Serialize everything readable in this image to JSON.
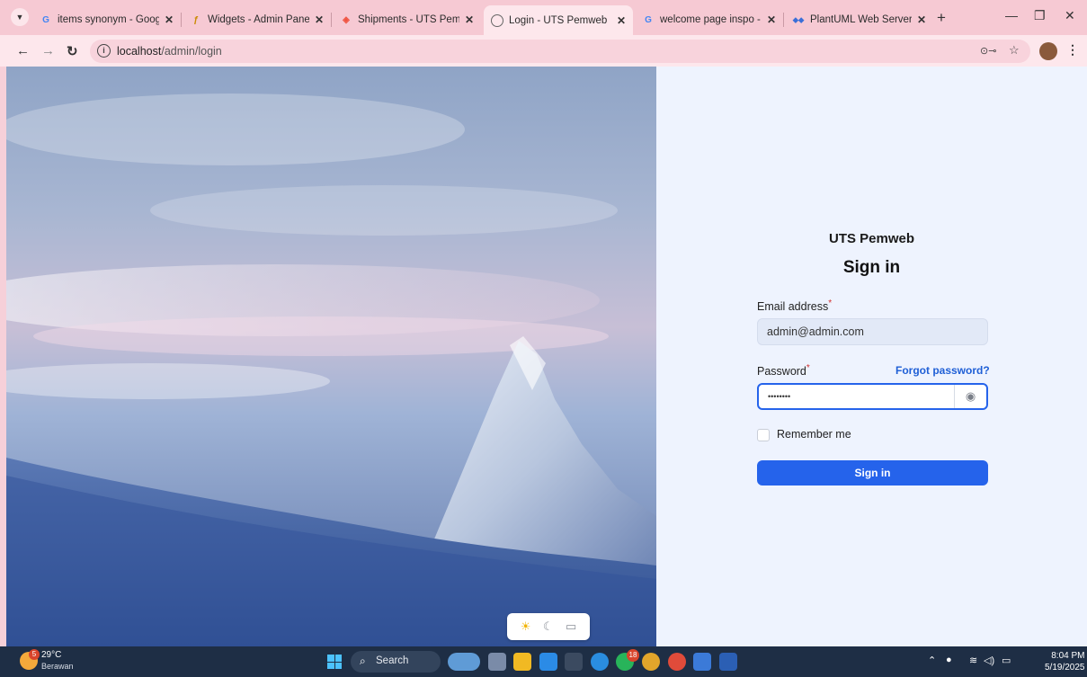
{
  "browser": {
    "tabs": [
      {
        "title": "items synonym - Google S",
        "favicon": "google-icon",
        "active": false
      },
      {
        "title": "Widgets - Admin Panel - F",
        "favicon": "filament-icon",
        "active": false
      },
      {
        "title": "Shipments - UTS Pemweb",
        "favicon": "laravel-icon",
        "active": false
      },
      {
        "title": "Login - UTS Pemweb",
        "favicon": "globe-icon",
        "active": true
      },
      {
        "title": "welcome page inspo - Goo",
        "favicon": "google-icon",
        "active": false
      },
      {
        "title": "PlantUML Web Server",
        "favicon": "plantuml-icon",
        "active": false
      }
    ],
    "tab_close_glyph": "✕",
    "new_tab_glyph": "+",
    "address": {
      "host": "localhost",
      "path": "/admin/login"
    }
  },
  "login": {
    "brand": "UTS Pemweb",
    "heading": "Sign in",
    "email_label": "Email address",
    "email_value": "admin@admin.com",
    "required_marker": "*",
    "password_label": "Password",
    "password_value": "••••••••",
    "forgot_link": "Forgot password?",
    "remember_label": "Remember me",
    "submit_label": "Sign in"
  },
  "theme_switcher": [
    "light-mode-icon",
    "dark-mode-icon",
    "system-mode-icon"
  ],
  "taskbar": {
    "weather": {
      "temp": "29°C",
      "condition": "Berawan",
      "badge": "5"
    },
    "search_label": "Search",
    "notification_badge": "18",
    "time": "8:04 PM",
    "date": "5/19/2025"
  },
  "colors": {
    "accent": "#2563eb",
    "panel_bg": "#eef3fe",
    "browser_chrome": "#f6c9d3",
    "taskbar": "#1e2e45"
  }
}
